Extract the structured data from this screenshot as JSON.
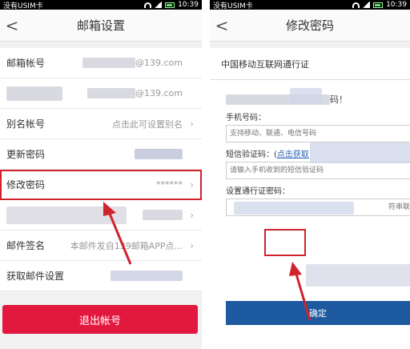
{
  "left": {
    "status": {
      "carrier": "没有USIM卡",
      "time": "10:39"
    },
    "header": {
      "title": "邮箱设置",
      "back": "<"
    },
    "rows": [
      {
        "label": "邮箱帐号",
        "value": "@139.com"
      },
      {
        "label": "",
        "value": "@139.com"
      },
      {
        "label": "别名帐号",
        "value": "点击此可设置别名"
      },
      {
        "label": "更新密码",
        "value": ""
      },
      {
        "label": "修改密码",
        "value": "******"
      },
      {
        "label": "",
        "value": ""
      },
      {
        "label": "邮件签名",
        "value": "本邮件发自139邮箱APP点..."
      },
      {
        "label": "获取邮件设置",
        "value": ""
      }
    ],
    "logout": "退出帐号"
  },
  "right": {
    "status": {
      "carrier": "没有USIM卡",
      "time": "10:39"
    },
    "header": {
      "title": "修改密码",
      "back": "<"
    },
    "section_title": "中国移动互联网通行证",
    "intro": "码！",
    "phone_label": "手机号码：",
    "phone_placeholder": "支持移动、联通、电信号码",
    "sms_label": "短信验证码：(",
    "sms_link": "点击获取",
    "sms_placeholder": "请输入手机收到的短信验证码",
    "pwd_label": "设置通行证密码：",
    "pwd_placeholder": "符串联",
    "confirm": "确定"
  },
  "colors": {
    "accent_red": "#e3183f",
    "highlight": "#d0232c",
    "confirm_blue": "#1d5aa0"
  }
}
